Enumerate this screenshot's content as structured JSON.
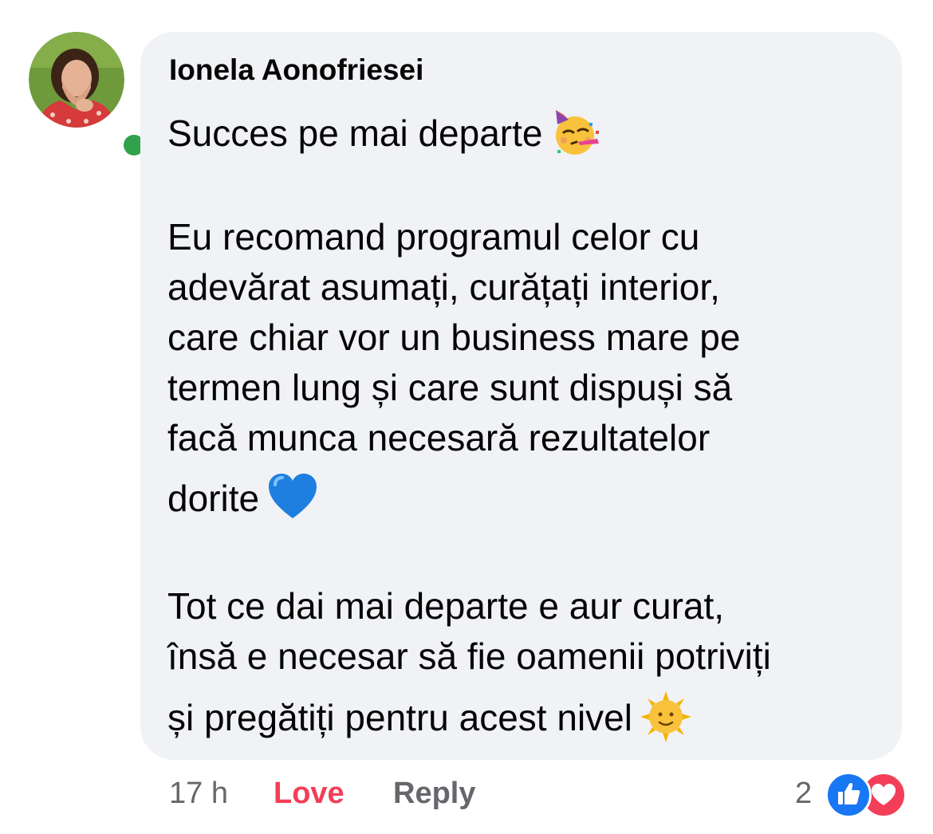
{
  "comment": {
    "author": "Ionela Aonofriesei",
    "lines": [
      "Succes pe mai departe",
      "Eu recomand programul celor cu",
      "adevărat asumați, curățați interior,",
      "care chiar vor un business mare pe",
      "termen lung și care sunt dispuși să",
      "facă munca necesară rezultatelor",
      "dorite",
      "Tot ce dai mai departe e aur curat,",
      "însă e necesar să fie oamenii potriviți",
      "și pregătiți pentru acest nivel"
    ],
    "emojis": [
      "partying-face-emoji",
      "blue-heart-emoji",
      "sun-with-face-emoji"
    ]
  },
  "footer": {
    "time": "17 h",
    "love_label": "Love",
    "reply_label": "Reply",
    "reaction_count": "2",
    "reaction_icons": [
      "like-icon",
      "love-icon"
    ]
  },
  "colors": {
    "bubble_bg": "#f0f2f5",
    "love": "#f33e58",
    "like": "#1877f2",
    "muted": "#65676b",
    "online": "#31a24c"
  }
}
